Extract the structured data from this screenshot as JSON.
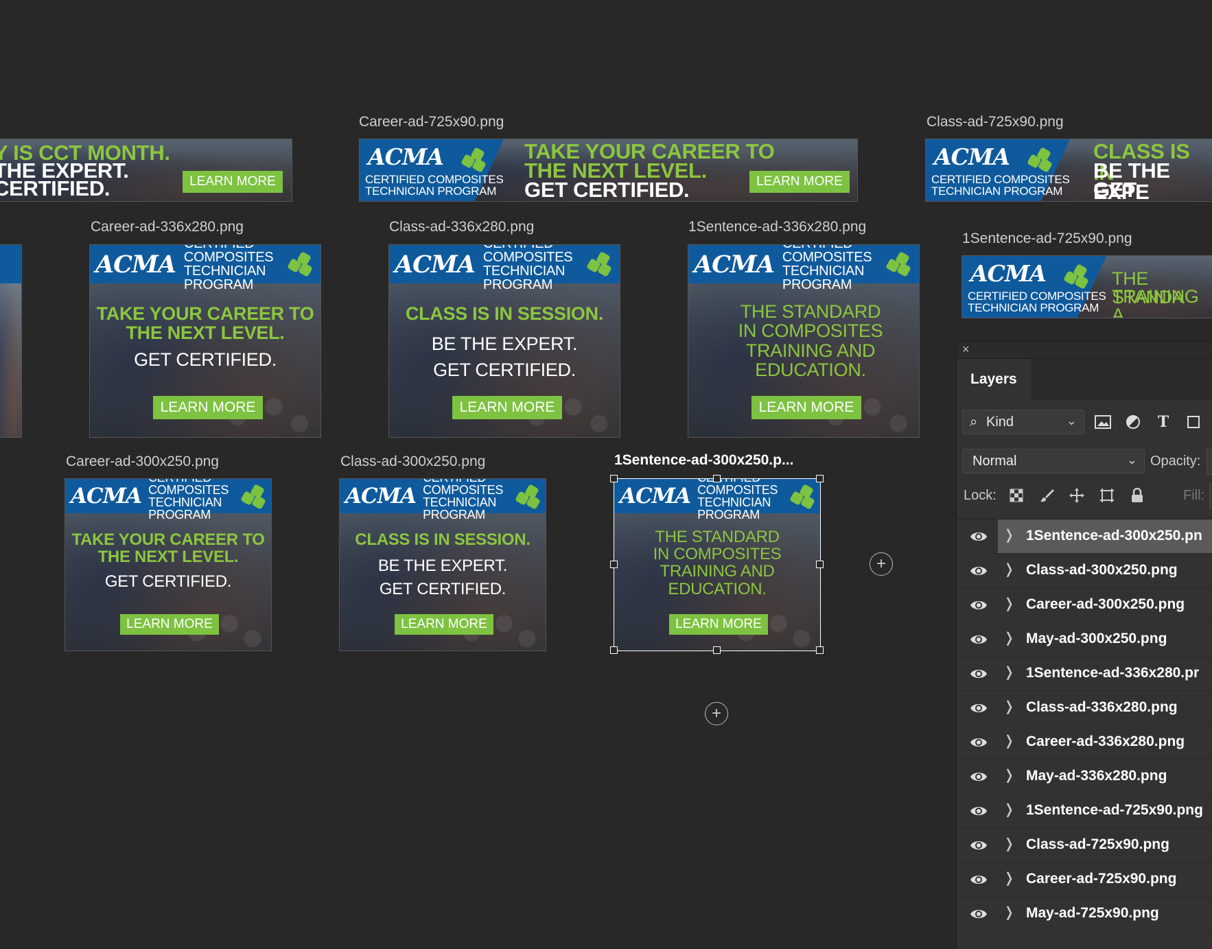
{
  "canvas": {
    "artboards": [
      {
        "id": "may-725",
        "label": "",
        "headline_green": "Y IS CCT MONTH.",
        "line2": "THE EXPERT.",
        "line3": "CERTIFIED.",
        "button": "LEARN MORE"
      },
      {
        "id": "career-725",
        "label": "Career-ad-725x90.png",
        "program": [
          "CERTIFIED COMPOSITES",
          "TECHNICIAN PROGRAM"
        ],
        "headline_green": "TAKE YOUR CAREER TO",
        "headline_green2": "THE NEXT LEVEL.",
        "line3": "GET CERTIFIED.",
        "button": "LEARN MORE"
      },
      {
        "id": "class-725",
        "label": "Class-ad-725x90.png",
        "program": [
          "CERTIFIED COMPOSITES",
          "TECHNICIAN PROGRAM"
        ],
        "headline_green": "CLASS IS IN",
        "line2": "BE THE EXPE",
        "line3": "GET CERTIFI"
      },
      {
        "id": "career-336",
        "label": "Career-ad-336x280.png",
        "program": [
          "CERTIFIED COMPOSITES",
          "TECHNICIAN PROGRAM"
        ],
        "green": [
          "TAKE YOUR CAREER TO",
          "THE NEXT LEVEL."
        ],
        "white": [
          "GET CERTIFIED."
        ],
        "button": "LEARN MORE"
      },
      {
        "id": "class-336",
        "label": "Class-ad-336x280.png",
        "program": [
          "CERTIFIED COMPOSITES",
          "TECHNICIAN PROGRAM"
        ],
        "green": [
          "CLASS IS IN SESSION."
        ],
        "white": [
          "BE THE EXPERT.",
          "GET CERTIFIED."
        ],
        "button": "LEARN MORE"
      },
      {
        "id": "sentence-336",
        "label": "1Sentence-ad-336x280.png",
        "program": [
          "CERTIFIED COMPOSITES",
          "TECHNICIAN PROGRAM"
        ],
        "green": [
          "THE STANDARD",
          "IN COMPOSITES",
          "TRAINING AND",
          "EDUCATION."
        ],
        "white": [],
        "button": "LEARN MORE"
      },
      {
        "id": "sentence-725",
        "label": "1Sentence-ad-725x90.png",
        "program": [
          "CERTIFIED COMPOSITES",
          "TECHNICIAN PROGRAM"
        ],
        "headline_green": "THE STANDA",
        "headline_green2": "TRAINING A"
      },
      {
        "id": "career-300",
        "label": "Career-ad-300x250.png",
        "program": [
          "CERTIFIED COMPOSITES",
          "TECHNICIAN PROGRAM"
        ],
        "green": [
          "TAKE YOUR CAREER TO",
          "THE NEXT LEVEL."
        ],
        "white": [
          "GET CERTIFIED."
        ],
        "button": "LEARN MORE"
      },
      {
        "id": "class-300",
        "label": "Class-ad-300x250.png",
        "program": [
          "CERTIFIED COMPOSITES",
          "TECHNICIAN PROGRAM"
        ],
        "green": [
          "CLASS IS IN SESSION."
        ],
        "white": [
          "BE THE EXPERT.",
          "GET CERTIFIED."
        ],
        "button": "LEARN MORE"
      },
      {
        "id": "sentence-300",
        "label": "1Sentence-ad-300x250.p...",
        "program": [
          "CERTIFIED COMPOSITES",
          "TECHNICIAN PROGRAM"
        ],
        "green": [
          "THE STANDARD",
          "IN COMPOSITES",
          "TRAINING AND",
          "EDUCATION."
        ],
        "white": [],
        "button": "LEARN MORE"
      }
    ],
    "logo_text": "ACMA",
    "add_icon": "plus-circle-icon"
  },
  "layers_panel": {
    "close": "×",
    "tab": "Layers",
    "kind_label": "Kind",
    "blend_mode": "Normal",
    "opacity_label": "Opacity:",
    "lock_label": "Lock:",
    "fill_label": "Fill:",
    "filter_icons": [
      "image-filter-icon",
      "adjustment-filter-icon",
      "type-filter-icon",
      "shape-filter-icon"
    ],
    "lock_icons": [
      "lock-pixels-icon",
      "lock-brush-icon",
      "lock-move-icon",
      "lock-artboard-icon",
      "lock-all-icon"
    ],
    "layers": [
      {
        "name": "1Sentence-ad-300x250.pn",
        "selected": true
      },
      {
        "name": "Class-ad-300x250.png",
        "selected": false
      },
      {
        "name": "Career-ad-300x250.png",
        "selected": false
      },
      {
        "name": "May-ad-300x250.png",
        "selected": false
      },
      {
        "name": "1Sentence-ad-336x280.pr",
        "selected": false
      },
      {
        "name": "Class-ad-336x280.png",
        "selected": false
      },
      {
        "name": "Career-ad-336x280.png",
        "selected": false
      },
      {
        "name": "May-ad-336x280.png",
        "selected": false
      },
      {
        "name": "1Sentence-ad-725x90.png",
        "selected": false
      },
      {
        "name": "Class-ad-725x90.png",
        "selected": false
      },
      {
        "name": "Career-ad-725x90.png",
        "selected": false
      },
      {
        "name": "May-ad-725x90.png",
        "selected": false
      }
    ]
  },
  "colors": {
    "canvas": "#282828",
    "brand_blue": "#0f5a9c",
    "brand_green": "#8cc63f",
    "button_green": "#7dc241"
  }
}
